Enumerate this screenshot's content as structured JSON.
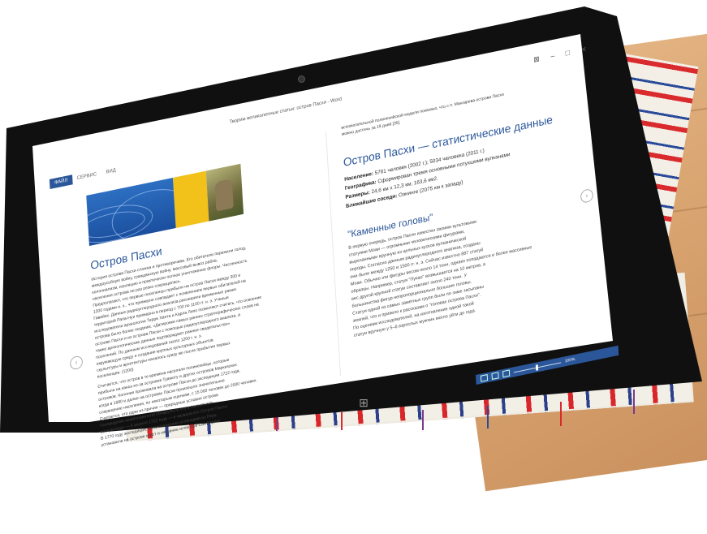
{
  "document": {
    "title": "Творим великолепные статьи: остров Пасхи - Word"
  },
  "ribbon": {
    "tabs": [
      "ФАЙЛ",
      "СЕРВИС",
      "ВИД"
    ]
  },
  "left_page": {
    "heading": "Остров Пасхи",
    "body_lines": [
      "История острова Пасхи сложна и противоречива. Его обитатели пережили голод,",
      "междоусобную войну, гражданскую войну, массовый вывоз рабов,",
      "колониализм, изоляцию и практически полное уничтожение флоры. Численность",
      "населения острова не раз резко сокращалась.",
      "Предполагают, что первые поселенцы прибыли на остров Пасхи между 300 и",
      "1200 годами н. э., что примерно совпадает с появлением первых обитателей на",
      "Гавайях. Данные радиоуглеродного анализа расширили временные рамки",
      "территорий Рапа-Нуи примерно в период с 700 по 1100 гг. н. э. Ученые",
      "исследователи археологии Терри Ханта и Карла Липо позволяют считать, что освоение",
      "острова было более поздним. «Датировки самых ранних стратиграфических слоев на",
      "острове Пасхи и из острова Пасхи с помощью радиоуглеродного анализа, а",
      "также археологические данные подтверждают раннее свидетельство»",
      "поселений. По данным исследований около 1200 г. н. э.",
      "окружающую среду и создание крупных культурных объектов",
      "скульптуры и архитектуры началось сразу же после прибытия первых",
      "поселенцев. (1200)"
    ],
    "body_lines_bottom": [
      "Считается, что остров в те времена населяли полинезийцы, которые",
      "прибыли на каноэ из-за островов Туамоту и других островов Маркизских",
      "островов. Колония проживала на острове Пасхи до экспедиции 1722 года,",
      "когда в 1680 и далее на островах Пасхи произошло значительное",
      "сокращение населения, по некоторым оценкам, с 15 000 человек до 2000 человек.",
      "Считается, что одни из причин — природные условия острова",
      "Голландские мореплаватели обнаружили его в пасхальное",
      "воскресенье — 5 апреля 1722 года — и назвали его Остров Пасхи.",
      "В 1770 году экспедиция, организованная испанцами из Перу,",
      "установила на острове крест и название испанцев Сан Карлос."
    ]
  },
  "right_page": {
    "intro_lines": [
      "вспомогательной полинезийской модели показано, что с п. Мангарева острова Пасхи",
      "можно достичь за 19 дней.[35]."
    ],
    "stats_heading": "Остров Пасхи — статистические данные",
    "facts": [
      {
        "label": "Население:",
        "value": "5761 человек (2002 г.); 5034 человека (2011 г.)"
      },
      {
        "label": "Географика:",
        "value": "Сформирован тремя основными потухшими вулканами"
      },
      {
        "label": "Размеры:",
        "value": "24,6 км х 12,3 км; 163,6 км2."
      },
      {
        "label": "Ближайшие соседи:",
        "value": "Оэнинге (2075 км к западу)"
      }
    ],
    "heads_heading": "\"Каменные головы\"",
    "heads_lines": [
      "В первую очередь, остров Пасхи известен своими культовыми",
      "статуями Моаи — огромными человеческими фигурами,",
      "вырезанными вручную из цельных кусков вулканической",
      "породы. Согласно данным радиоуглеродного анализа, созданы",
      "они были между 1250 и 1500 гг. н. э. Сейчас известно 887 статуй",
      "Моаи. Обычно эти фигуры весом около 14 тонн, однако попадаются и более массивные",
      "образцы. Например, статуя \"Пукао\" возвышается на 10 метров, а",
      "вес другой крупной статуи составляет около 240 тонн. У",
      "большинства фигур непропорционально большие головы.",
      "Статуи одной из самых заметных групп были по зиме засыпаны",
      "землей, что и привело к рассказам о \"головах острова Пасхи\".",
      "По оценкам исследователей, на изготовление одной такой",
      "статуи вручную у 5–6 взрослых мужчин могло уйти до года."
    ]
  },
  "status": {
    "zoom": "100%"
  },
  "icons": {
    "prev": "chevron-left-icon",
    "next": "chevron-right-icon",
    "windows": "windows-logo-icon",
    "close": "close-icon",
    "minimize": "minimize-icon",
    "maximize": "maximize-icon",
    "options": "options-icon"
  },
  "colors": {
    "accent": "#2b579a",
    "bezel": "#101010",
    "yellow_tile": "#f2c21a"
  }
}
